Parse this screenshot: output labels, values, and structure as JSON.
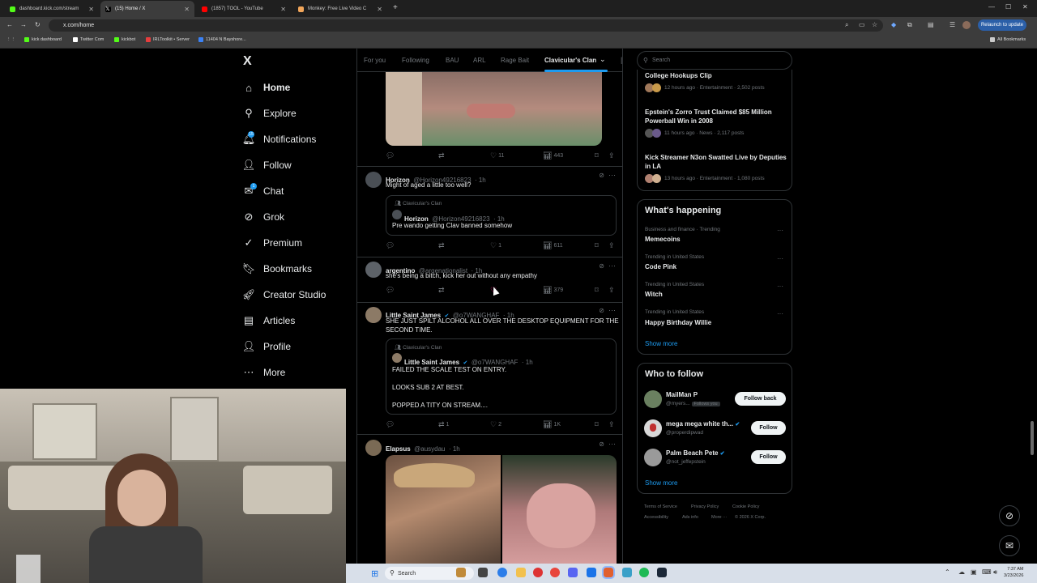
{
  "browser": {
    "tabs": [
      {
        "title": "dashboard.kick.com/stream",
        "color": "#53fc18"
      },
      {
        "title": "(15) Home / X",
        "color": "#ffffff"
      },
      {
        "title": "(1857) TOOL - YouTube",
        "color": "#ff0000"
      },
      {
        "title": "Monkey: Free Live Video C",
        "color": "#f2a65a"
      }
    ],
    "url": "x.com/home",
    "relaunch": "Relaunch to update",
    "bookmarks": [
      "kick dashboard",
      "Twitter Com",
      "kickbot",
      "IRLToolkit • Server",
      "11404 N Bayshore..."
    ],
    "all_bookmarks": "All Bookmarks"
  },
  "nav": {
    "logo": "X",
    "items": [
      {
        "label": "Home",
        "icon": "home-icon"
      },
      {
        "label": "Explore",
        "icon": "search-icon"
      },
      {
        "label": "Notifications",
        "icon": "bell-icon"
      },
      {
        "label": "Follow",
        "icon": "person-plus-icon"
      },
      {
        "label": "Chat",
        "icon": "mail-icon"
      },
      {
        "label": "Grok",
        "icon": "grok-icon"
      },
      {
        "label": "Premium",
        "icon": "check-badge-icon"
      },
      {
        "label": "Bookmarks",
        "icon": "bookmark-icon"
      },
      {
        "label": "Creator Studio",
        "icon": "rocket-icon"
      },
      {
        "label": "Articles",
        "icon": "article-icon"
      },
      {
        "label": "Profile",
        "icon": "person-icon"
      },
      {
        "label": "More",
        "icon": "more-circle-icon"
      }
    ],
    "notif_badge": "15",
    "chat_badge": "1"
  },
  "feed": {
    "tabs": [
      "For you",
      "Following",
      "BAU",
      "ARL",
      "Rage Bait",
      "Clavicular's Clan"
    ],
    "active_tab": "Clavicular's Clan",
    "tweets": [
      {
        "actions": {
          "reply": "",
          "repost": "",
          "like": "11",
          "views": "443"
        }
      },
      {
        "name": "Horizon",
        "handle": "@Horizon49216823",
        "time": "· 1h",
        "text": "Might of aged a little too well?",
        "quote": {
          "community": "Clavicular's Clan",
          "name": "Horizon",
          "handle": "@Horizon49216823",
          "time": "· 1h",
          "text": "Pre wando getting Clav banned somehow"
        },
        "actions": {
          "reply": "",
          "repost": "",
          "like": "1",
          "views": "611"
        }
      },
      {
        "name": "argentino",
        "handle": "@argenationalist",
        "time": "· 1h",
        "text": "she's being a bitch, kick her out without any empathy",
        "actions": {
          "reply": "",
          "repost": "",
          "like": "",
          "views": "379"
        }
      },
      {
        "name": "Little Saint James",
        "handle": "@o7WANGHAF",
        "time": "· 1h",
        "text": "SHE JUST SPILT ALCOHOL ALL OVER THE DESKTOP EQUIPMENT FOR THE SECOND TIME.",
        "quote": {
          "community": "Clavicular's Clan",
          "name": "Little Saint James",
          "handle": "@o7WANGHAF",
          "time": "· 1h",
          "lines": [
            "FAILED THE SCALE TEST ON ENTRY.",
            "LOOKS SUB 2 AT BEST.",
            "POPPED A TITY ON STREAM...."
          ]
        },
        "actions": {
          "reply": "",
          "repost": "1",
          "like": "2",
          "views": "1K"
        }
      },
      {
        "name": "Elapsus",
        "handle": "@ausydau",
        "time": "· 1h"
      }
    ]
  },
  "search": {
    "placeholder": "Search"
  },
  "trends_top": [
    {
      "title": "College Hookups Clip",
      "meta": "12 hours ago · Entertainment · 2,502 posts"
    },
    {
      "title": "Epstein's Zorro Trust Claimed $85 Million Powerball Win in 2008",
      "meta": "11 hours ago · News · 2,117 posts"
    },
    {
      "title": "Kick Streamer N3on Swatted Live by Deputies in LA",
      "meta": "13 hours ago · Entertainment · 1,080 posts"
    }
  ],
  "happening": {
    "title": "What's happening",
    "items": [
      {
        "context": "Business and finance · Trending",
        "name": "Memecoins"
      },
      {
        "context": "Trending in United States",
        "name": "Code Pink"
      },
      {
        "context": "Trending in United States",
        "name": "Witch"
      },
      {
        "context": "Trending in United States",
        "name": "Happy Birthday Willie"
      }
    ],
    "show_more": "Show more"
  },
  "who_to_follow": {
    "title": "Who to follow",
    "users": [
      {
        "name": "MailMan P",
        "handle": "@myers...",
        "tag": "Follows you",
        "button": "Follow back"
      },
      {
        "name": "mega mega white th...",
        "handle": "@properdipwad",
        "button": "Follow"
      },
      {
        "name": "Palm Beach Pete",
        "handle": "@not_jeffepstein",
        "button": "Follow"
      }
    ],
    "show_more": "Show more"
  },
  "footer": [
    "Terms of Service",
    "Privacy Policy",
    "Cookie Policy",
    "Accessibility",
    "Ads info",
    "More ···",
    "© 2026 X Corp."
  ],
  "taskbar": {
    "search": "Search",
    "time": "7:37 AM",
    "date": "3/23/2026"
  }
}
